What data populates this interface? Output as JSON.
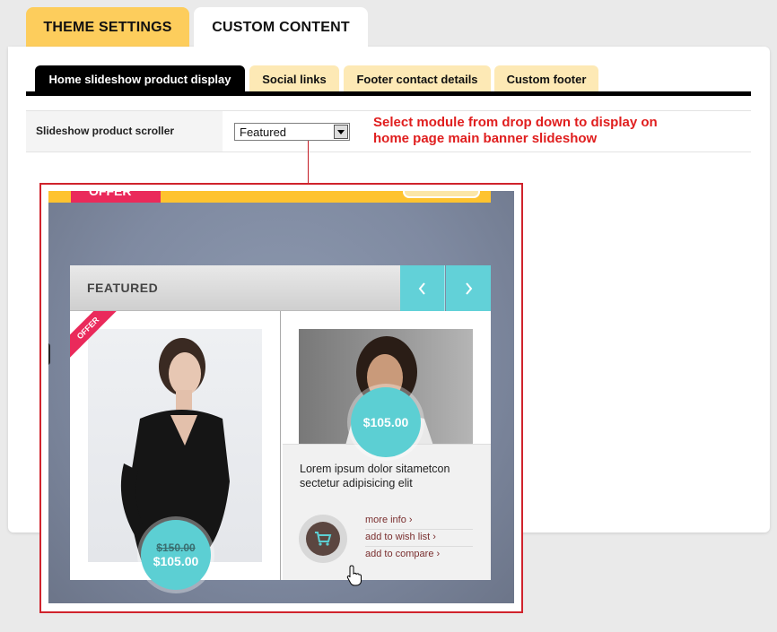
{
  "top_tabs": [
    {
      "label": "THEME SETTINGS",
      "active": false
    },
    {
      "label": "CUSTOM CONTENT",
      "active": true
    }
  ],
  "sub_tabs": [
    {
      "label": "Home slideshow product display",
      "active": true
    },
    {
      "label": "Social links",
      "active": false
    },
    {
      "label": "Footer contact details",
      "active": false
    },
    {
      "label": "Custom footer",
      "active": false
    }
  ],
  "setting": {
    "label": "Slideshow product scroller",
    "selected_value": "Featured"
  },
  "hint": {
    "line1": "Select module from drop down to display on",
    "line2": "home page main banner slideshow"
  },
  "preview": {
    "banner_offer": "OFFER",
    "section_title": "FEATURED",
    "products": [
      {
        "ribbon": "OFFER",
        "old_price": "$150.00",
        "price": "$105.00"
      },
      {
        "price": "$105.00",
        "description_line1": "Lorem ipsum dolor sitametcon",
        "description_line2": "sectetur adipisicing elit",
        "links": [
          "more info",
          "add to wish list",
          "add to compare"
        ]
      }
    ]
  },
  "colors": {
    "theme_tab": "#fdcd5c",
    "sub_tab_inactive": "#fde9b5",
    "accent_teal": "#5ccfd3",
    "hint_red": "#e01e1e",
    "offer_pink": "#ea2a5b"
  }
}
